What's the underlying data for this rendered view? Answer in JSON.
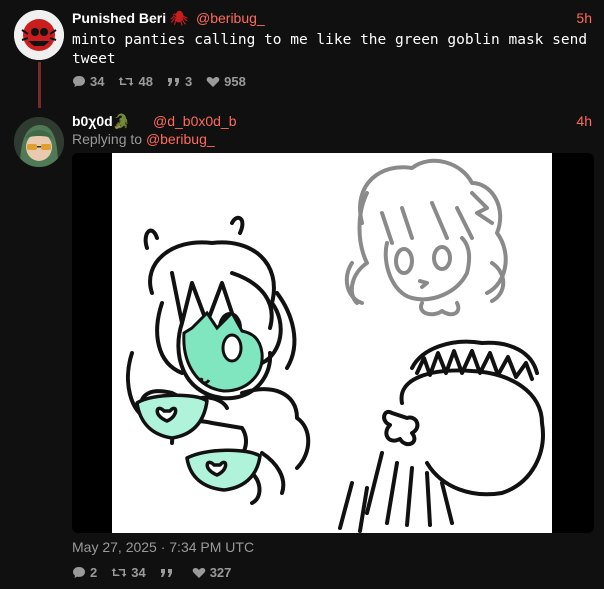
{
  "tweets": [
    {
      "author": "Punished Beri",
      "author_emoji": "🕷",
      "handle": "@beribug_",
      "time": "5h",
      "text": "minto panties calling to me like the green goblin mask send tweet",
      "stats": {
        "replies": "34",
        "retweets": "48",
        "quotes": "3",
        "likes": "958"
      }
    },
    {
      "author": "b0χ0d🐊",
      "handle": "@d_b0x0d_b",
      "time": "4h",
      "reply_prefix": "Replying to",
      "reply_to": "@beribug_",
      "date": "May 27, 2025 · 7:34 PM UTC",
      "stats": {
        "replies": "2",
        "retweets": "34",
        "quotes": "",
        "likes": "327"
      }
    }
  ],
  "colors": {
    "accent": "#ff6b5a",
    "background": "#101010",
    "muted": "#9a9a9a",
    "thread": "#7b2a2a",
    "mint": "#aef3da"
  },
  "icons": [
    "comment-icon",
    "retweet-icon",
    "quote-icon",
    "heart-icon"
  ]
}
